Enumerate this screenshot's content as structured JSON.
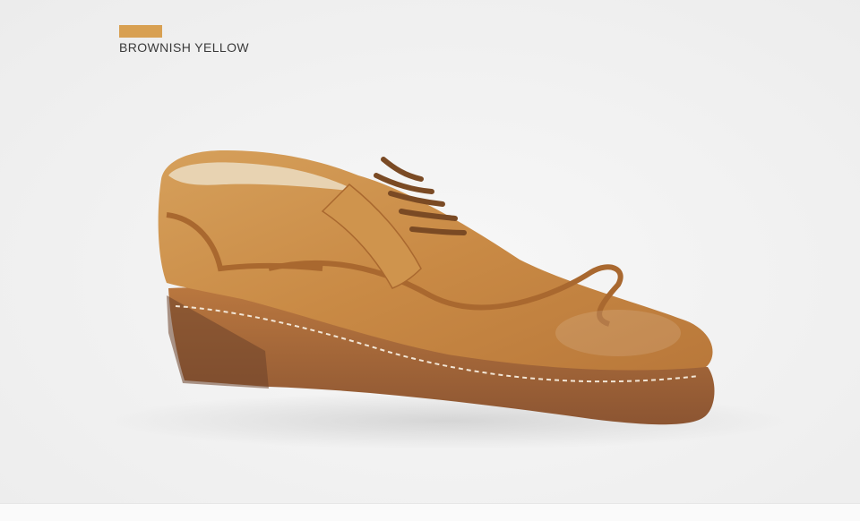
{
  "color_option": {
    "label": "BROWNISH YELLOW",
    "swatch_color": "#d8a052"
  },
  "product_image": {
    "icon": "shoe-image",
    "leather_color": "#c98a45",
    "sole_color": "#a8693c"
  }
}
